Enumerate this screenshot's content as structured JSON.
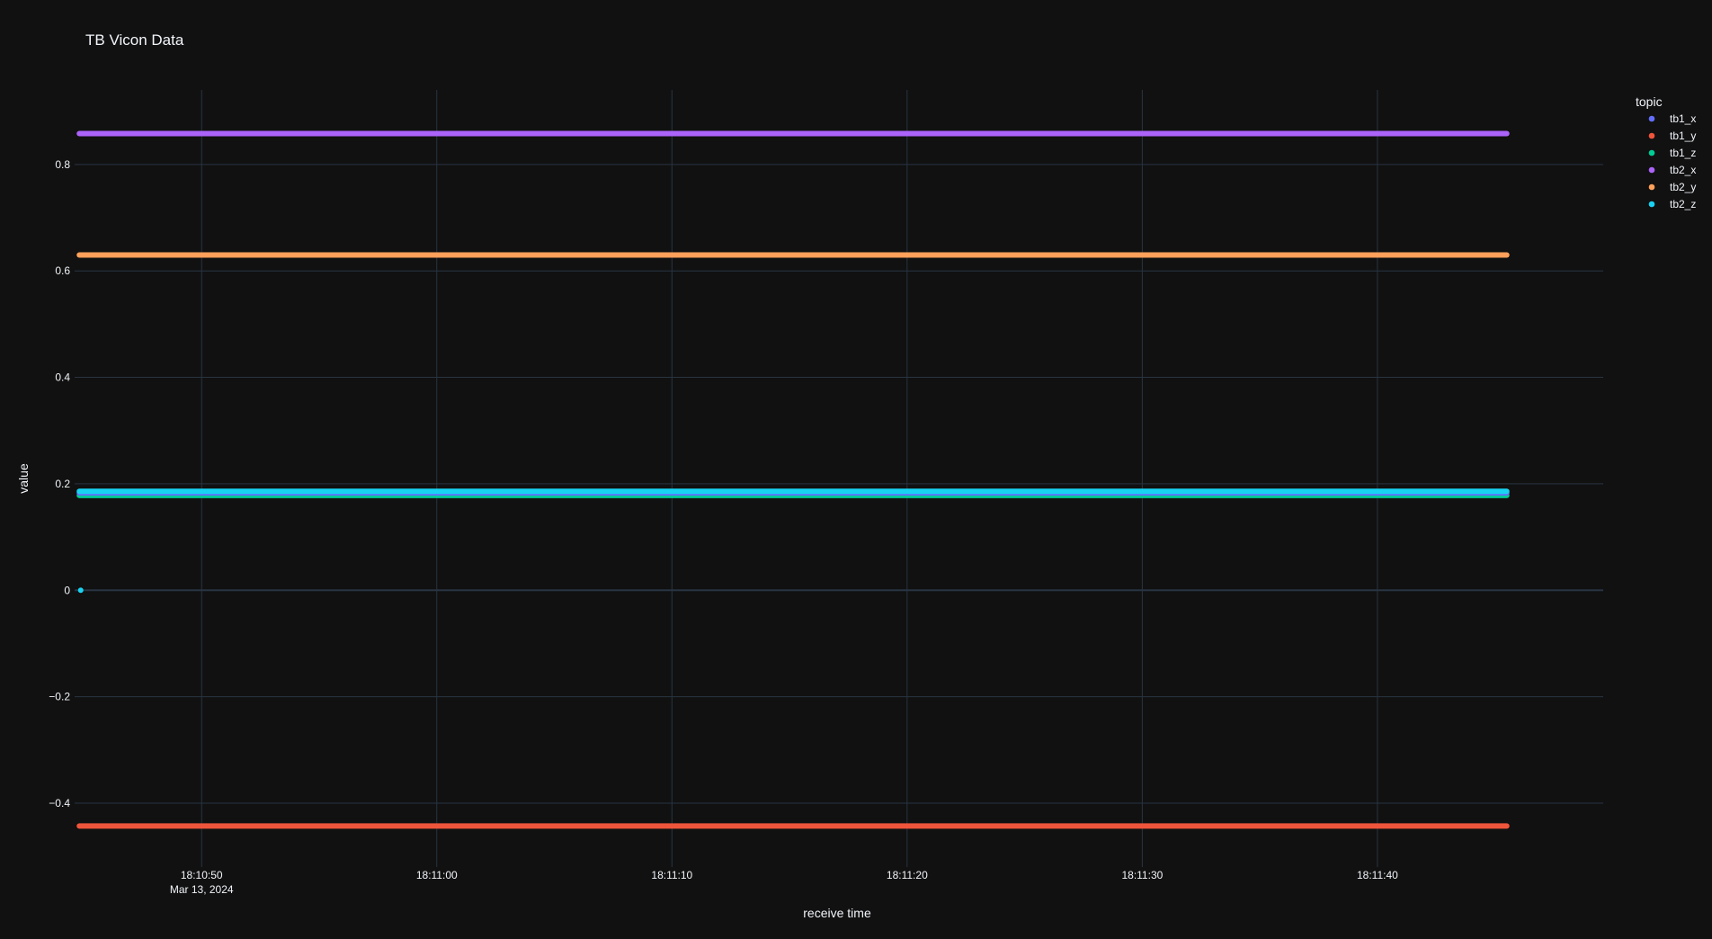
{
  "chart_data": {
    "type": "scatter",
    "title": "TB Vicon Data",
    "xlabel": "receive time",
    "ylabel": "value",
    "x_range": [
      "2024-03-13 18:10:44.6",
      "2024-03-13 18:11:49.6"
    ],
    "y_range": [
      -0.52,
      0.94
    ],
    "x_ticks": [
      {
        "t": "2024-03-13 18:10:50",
        "label": "18:10:50",
        "sublabel": "Mar 13, 2024"
      },
      {
        "t": "2024-03-13 18:11:00",
        "label": "18:11:00"
      },
      {
        "t": "2024-03-13 18:11:10",
        "label": "18:11:10"
      },
      {
        "t": "2024-03-13 18:11:20",
        "label": "18:11:20"
      },
      {
        "t": "2024-03-13 18:11:30",
        "label": "18:11:30"
      },
      {
        "t": "2024-03-13 18:11:40",
        "label": "18:11:40"
      }
    ],
    "y_ticks": [
      {
        "v": 0.8,
        "label": "0.8"
      },
      {
        "v": 0.6,
        "label": "0.6"
      },
      {
        "v": 0.4,
        "label": "0.4"
      },
      {
        "v": 0.2,
        "label": "0.2"
      },
      {
        "v": 0,
        "label": "0"
      },
      {
        "v": -0.2,
        "label": "−0.2"
      },
      {
        "v": -0.4,
        "label": "−0.4"
      }
    ],
    "grid": true,
    "legend": {
      "title": "topic",
      "placement": "top-right"
    },
    "series": [
      {
        "name": "tb1_x",
        "color": "#636efa",
        "x_start": "2024-03-13 18:10:44.8",
        "x_end": "2024-03-13 18:11:45.5",
        "value": 0.183
      },
      {
        "name": "tb1_y",
        "color": "#EF553B",
        "x_start": "2024-03-13 18:10:44.8",
        "x_end": "2024-03-13 18:11:45.5",
        "value": -0.443
      },
      {
        "name": "tb1_z",
        "color": "#00cc96",
        "x_start": "2024-03-13 18:10:44.8",
        "x_end": "2024-03-13 18:11:45.5",
        "value": 0.178
      },
      {
        "name": "tb2_x",
        "color": "#ab63fa",
        "x_start": "2024-03-13 18:10:44.8",
        "x_end": "2024-03-13 18:11:45.5",
        "value": 0.858
      },
      {
        "name": "tb2_y",
        "color": "#FFA15A",
        "x_start": "2024-03-13 18:10:44.8",
        "x_end": "2024-03-13 18:11:45.5",
        "value": 0.63
      },
      {
        "name": "tb2_z",
        "color": "#19d3f3",
        "x_start": "2024-03-13 18:10:44.8",
        "x_end": "2024-03-13 18:11:45.5",
        "value": 0.186,
        "first_value": 0
      }
    ]
  }
}
